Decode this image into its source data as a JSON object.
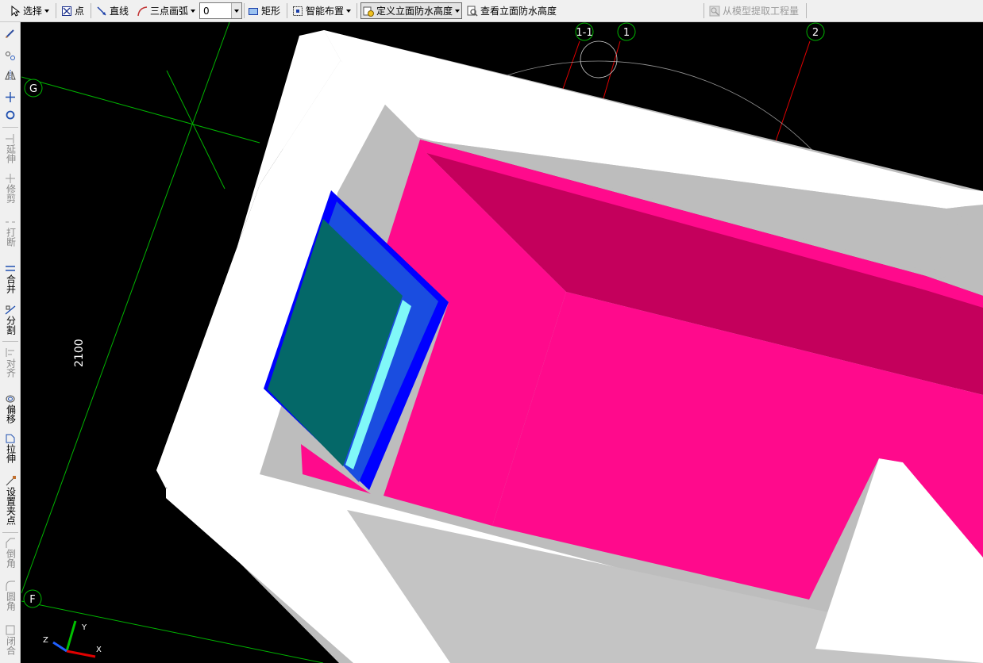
{
  "toolbar": {
    "select_label": "选择",
    "point_label": "点",
    "line_label": "直线",
    "arc_label": "三点画弧",
    "arc_value": "0",
    "rect_label": "矩形",
    "smart_layout_label": "智能布置",
    "define_height_label": "定义立面防水高度",
    "view_height_label": "查看立面防水高度",
    "extract_label": "从模型提取工程量"
  },
  "left_toolbar": {
    "extend": "延伸",
    "trim": "修剪",
    "break": "打断",
    "merge": "合并",
    "split": "分割",
    "align": "对齐",
    "offset": "偏移",
    "stretch": "拉伸",
    "set_grip": "设置夹点",
    "chamfer": "倒角",
    "fillet": "圆角",
    "close": "闭合"
  },
  "viewport": {
    "axis_labels": {
      "g": "G",
      "f": "F",
      "a1_1": "1-1",
      "a1": "1",
      "a2": "2"
    },
    "dimension": "2100",
    "ucs": {
      "x": "X",
      "y": "Y",
      "z": "Z"
    },
    "colors": {
      "background": "#000000",
      "wall": "#ffffff",
      "wall_shade": "#bdbdbd",
      "waterproof": "#ff0a8c",
      "waterproof_dark": "#c4005c",
      "glass": "#046868",
      "frame": "#0000ff",
      "axis_green": "#00b400",
      "axis_red": "#e00000"
    }
  }
}
